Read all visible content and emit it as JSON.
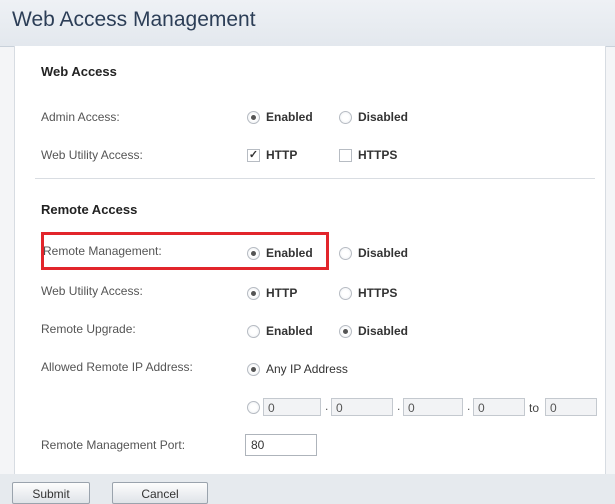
{
  "header": {
    "title": "Web Access Management"
  },
  "web_access": {
    "section_title": "Web Access",
    "admin_access": {
      "label": "Admin Access:",
      "enabled": "Enabled",
      "disabled": "Disabled",
      "selected": "Enabled"
    },
    "web_utility_access": {
      "label": "Web Utility Access:",
      "http": "HTTP",
      "https": "HTTPS",
      "http_checked": true,
      "https_checked": false
    }
  },
  "remote_access": {
    "section_title": "Remote Access",
    "remote_management": {
      "label": "Remote Management:",
      "enabled": "Enabled",
      "disabled": "Disabled",
      "selected": "Enabled"
    },
    "web_utility_access": {
      "label": "Web Utility Access:",
      "http": "HTTP",
      "https": "HTTPS",
      "selected": "HTTP"
    },
    "remote_upgrade": {
      "label": "Remote Upgrade:",
      "enabled": "Enabled",
      "disabled": "Disabled",
      "selected": "Disabled"
    },
    "allowed_remote_ip": {
      "label": "Allowed Remote IP Address:",
      "any_ip": "Any IP Address",
      "selected": "any",
      "range": [
        "0",
        "0",
        "0",
        "0"
      ],
      "to_label": "to",
      "to_value": "0"
    },
    "remote_management_port": {
      "label": "Remote Management Port:",
      "value": "80"
    }
  },
  "buttons": {
    "submit": "Submit",
    "cancel": "Cancel"
  },
  "colors": {
    "highlight": "#e2252b"
  }
}
